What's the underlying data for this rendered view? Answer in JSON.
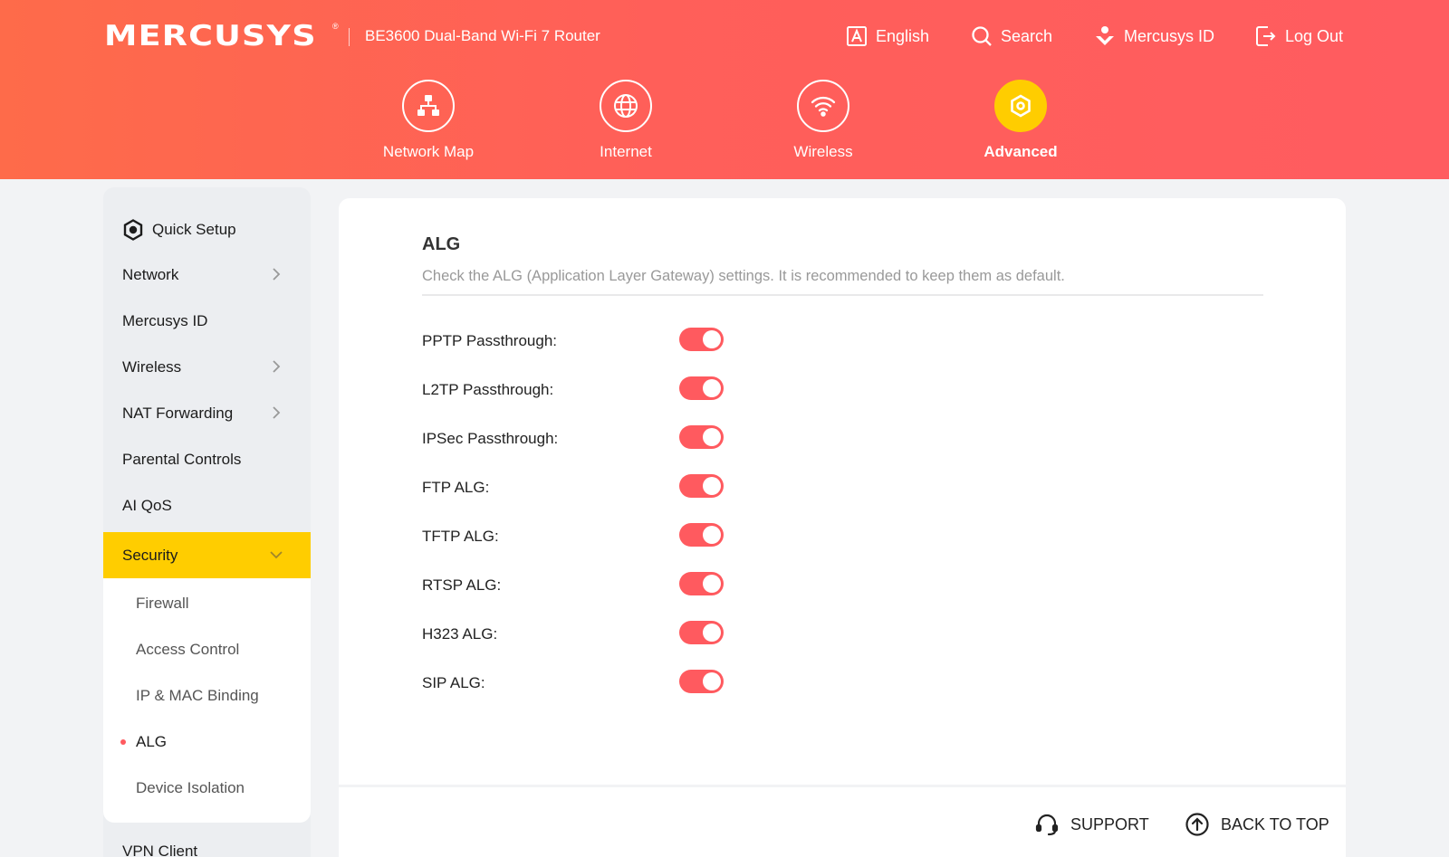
{
  "header": {
    "logo": "MERCUSYS",
    "trademark": "®",
    "model": "BE3600 Dual-Band Wi-Fi 7 Router",
    "links": {
      "language": "English",
      "search": "Search",
      "account": "Mercusys ID",
      "logout": "Log Out"
    }
  },
  "nav": [
    {
      "label": "Network Map",
      "icon": "network-map-icon"
    },
    {
      "label": "Internet",
      "icon": "globe-icon"
    },
    {
      "label": "Wireless",
      "icon": "wifi-icon"
    },
    {
      "label": "Advanced",
      "icon": "gear-icon",
      "active": true
    }
  ],
  "sidebar": {
    "items": [
      {
        "label": "Quick Setup"
      },
      {
        "label": "Network"
      },
      {
        "label": "Mercusys ID"
      },
      {
        "label": "Wireless"
      },
      {
        "label": "NAT Forwarding"
      },
      {
        "label": "Parental Controls"
      },
      {
        "label": "AI QoS"
      },
      {
        "label": "Security",
        "expanded": true
      },
      {
        "label": "VPN Client"
      }
    ],
    "security_sub": [
      {
        "label": "Firewall"
      },
      {
        "label": "Access Control"
      },
      {
        "label": "IP & MAC Binding"
      },
      {
        "label": "ALG",
        "current": true
      },
      {
        "label": "Device Isolation"
      }
    ]
  },
  "main": {
    "title": "ALG",
    "description": "Check the ALG (Application Layer Gateway) settings. It is recommended to keep them as default.",
    "settings": [
      {
        "label": "PPTP Passthrough:",
        "enabled": true
      },
      {
        "label": "L2TP Passthrough:",
        "enabled": true
      },
      {
        "label": "IPSec Passthrough:",
        "enabled": true
      },
      {
        "label": "FTP ALG:",
        "enabled": true
      },
      {
        "label": "TFTP ALG:",
        "enabled": true
      },
      {
        "label": "RTSP ALG:",
        "enabled": true
      },
      {
        "label": "H323 ALG:",
        "enabled": true
      },
      {
        "label": "SIP ALG:",
        "enabled": true
      }
    ]
  },
  "footer": {
    "support": "SUPPORT",
    "back_to_top": "BACK TO TOP"
  },
  "colors": {
    "header_start": "#fe6b4a",
    "header_end": "#ff5c60",
    "accent_yellow": "#ffcd00",
    "toggle_on": "#ff5a5f"
  }
}
